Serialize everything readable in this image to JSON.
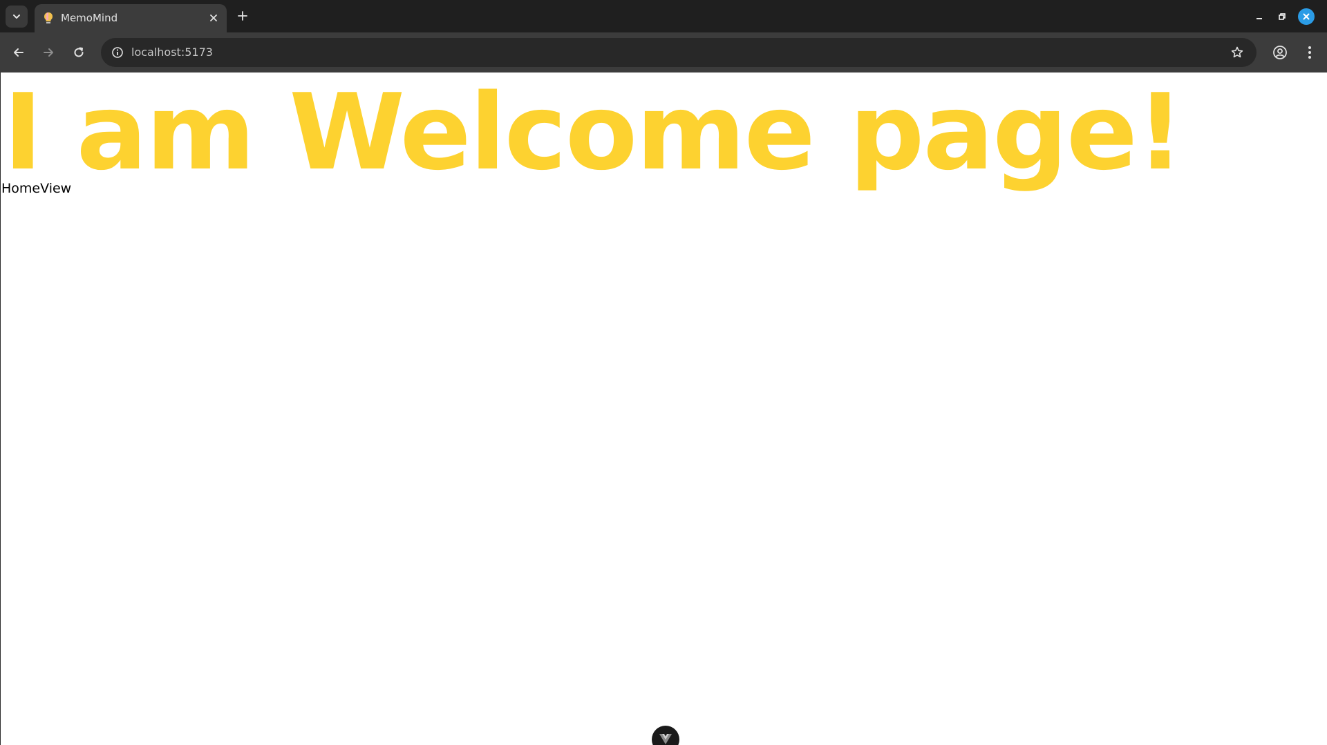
{
  "browser": {
    "tab": {
      "title": "MemoMind",
      "favicon": "lightbulb-icon"
    },
    "address_bar": {
      "url": "localhost:5173"
    },
    "icons": {
      "tab_search": "chevron-down-icon",
      "tab_close": "close-icon",
      "new_tab": "plus-icon",
      "back": "arrow-left-icon",
      "forward": "arrow-right-icon",
      "reload": "reload-icon",
      "site_info": "info-icon",
      "bookmark": "star-icon",
      "profile": "profile-icon",
      "menu": "kebab-menu-icon",
      "minimize": "minimize-icon",
      "maximize": "restore-icon",
      "close_window": "close-icon"
    },
    "colors": {
      "frame": "#1f1f1f",
      "toolbar": "#3c3c3c",
      "omnibox": "#282828",
      "close_window": "#2b9ce6"
    }
  },
  "page": {
    "heading": "I am Welcome page!",
    "subtext": "HomeView",
    "devtools_toggle_icon": "vue-logo-icon",
    "colors": {
      "heading": "#fdd230",
      "text": "#000000",
      "background": "#ffffff"
    }
  }
}
